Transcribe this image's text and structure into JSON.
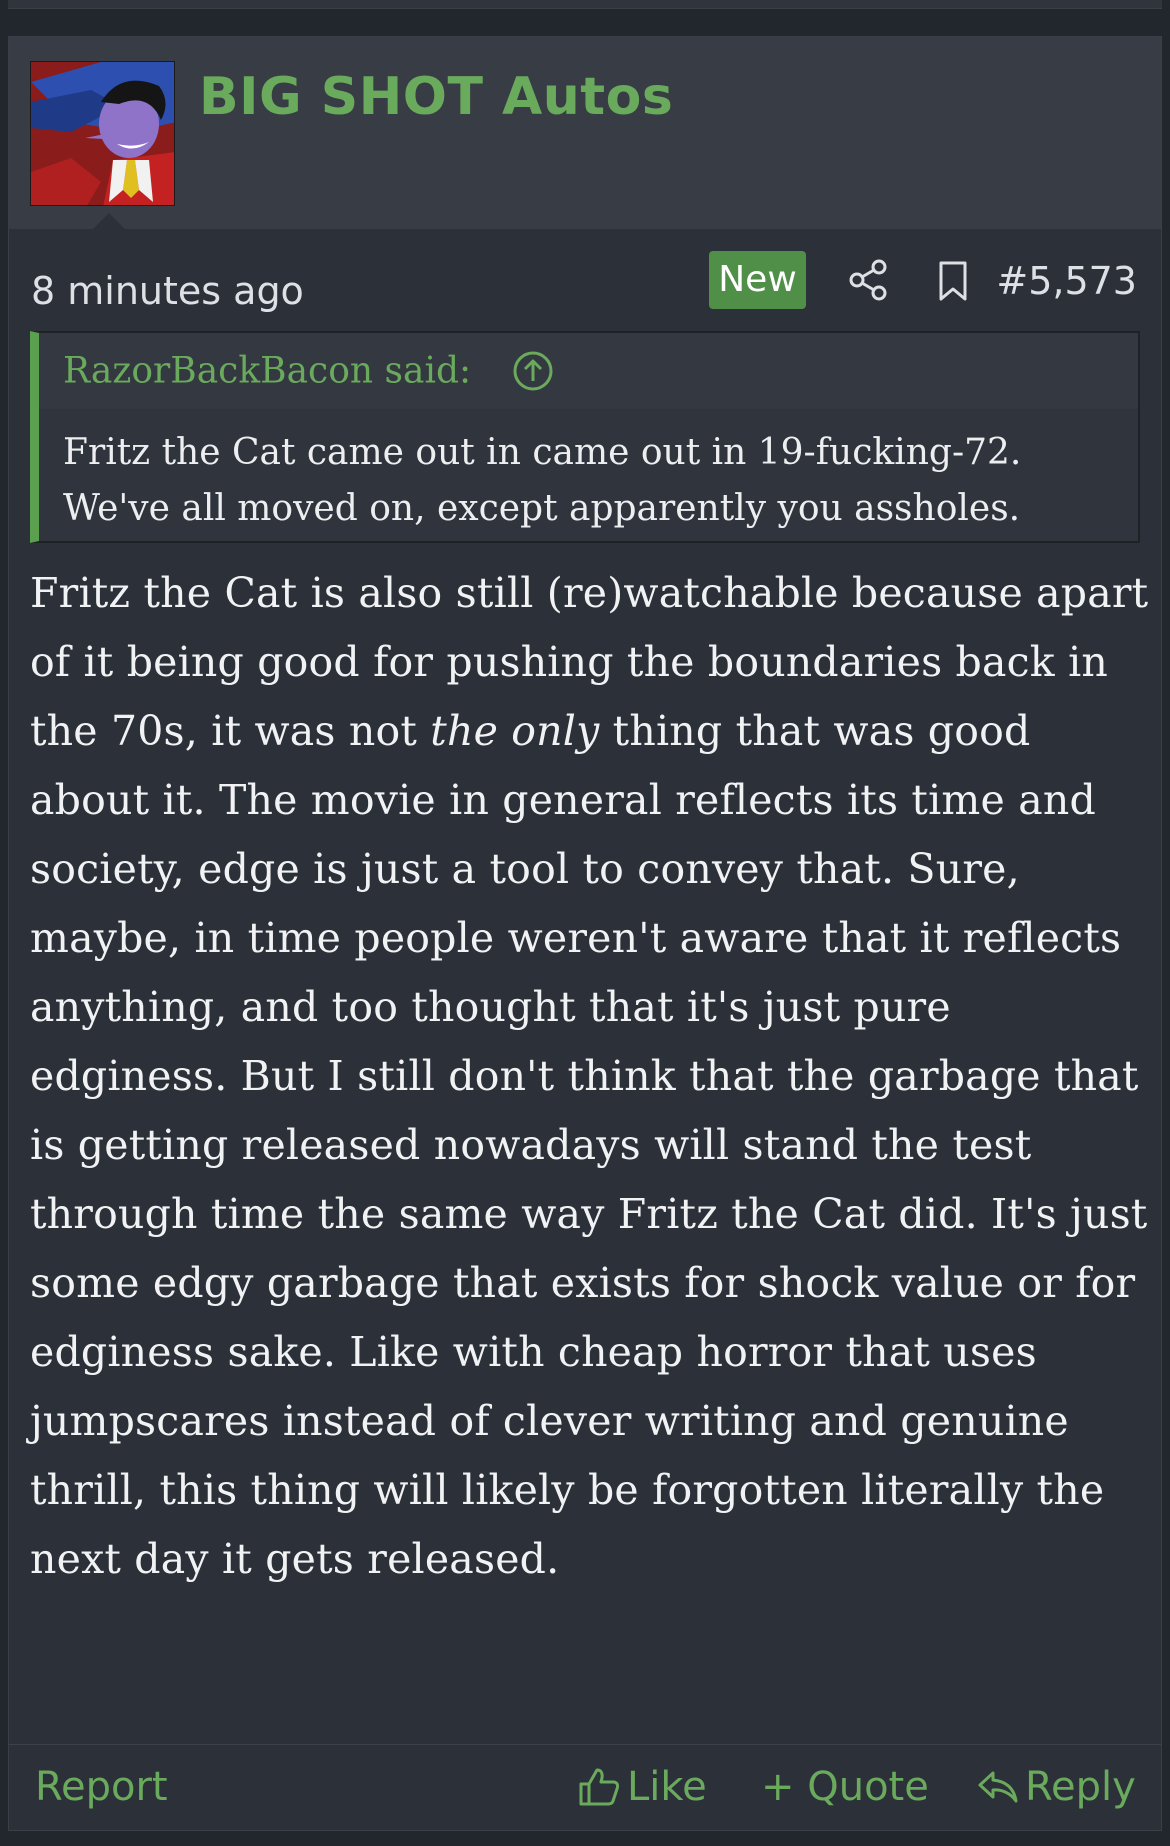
{
  "post": {
    "username": "BIG SHOT Autos",
    "timestamp": "8 minutes ago",
    "badge": "New",
    "post_number": "#5,573",
    "quote": {
      "author_label": "RazorBackBacon said:",
      "lines": [
        "Fritz the Cat came out in came out in 19-fucking-72.",
        "We've all moved on, except apparently you assholes."
      ]
    },
    "message": {
      "before_em": "Fritz the Cat is also still (re)watchable because apart of it being good for pushing the boundaries back in the 70s, it was not ",
      "em": "the only",
      "after_em": " thing that was good about it. The movie in general reflects its time and society, edge is just a tool to convey that. Sure, maybe, in time people weren't aware that it reflects anything, and too thought that it's just pure edginess. But I still don't think that the garbage that is getting released nowadays will stand the test through time the same way Fritz the Cat did. It's just some edgy garbage that exists for shock value or for edginess sake. Like with cheap horror that uses jumpscares instead of clever writing and genuine thrill, this thing will likely be forgotten literally the next day it gets released."
    },
    "actions": {
      "report": "Report",
      "like": "Like",
      "quote": "+ Quote",
      "reply": "Reply"
    }
  },
  "colors": {
    "accent": "#6aaa5c",
    "badge_bg": "#4f8f47",
    "post_bg": "#2c3038",
    "header_bg": "#383c44",
    "page_bg": "#22262d"
  },
  "icons": {
    "share": "share-icon",
    "bookmark": "bookmark-icon",
    "quote_jump": "arrow-up-circle-icon",
    "like": "thumbs-up-icon",
    "reply": "reply-arrow-icon"
  }
}
